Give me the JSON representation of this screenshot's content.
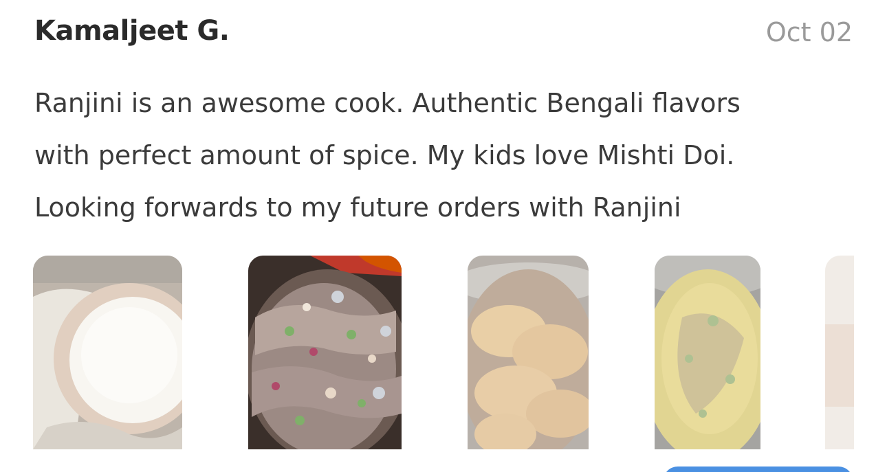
{
  "review": {
    "reviewer_name": "Kamaljeet G.",
    "date": "Oct 02",
    "text_lines": [
      "Ranjini is an awesome cook. Authentic Bengali flavors",
      "with perfect amount of spice. My kids love Mishti Doi.",
      "Looking forwards to my future orders with Ranjini"
    ]
  },
  "colors": {
    "name_text": "#2a2a2a",
    "date_text": "#9a9a9a",
    "body_text": "#3b3b3b",
    "cta_button": "#4a90e2"
  }
}
